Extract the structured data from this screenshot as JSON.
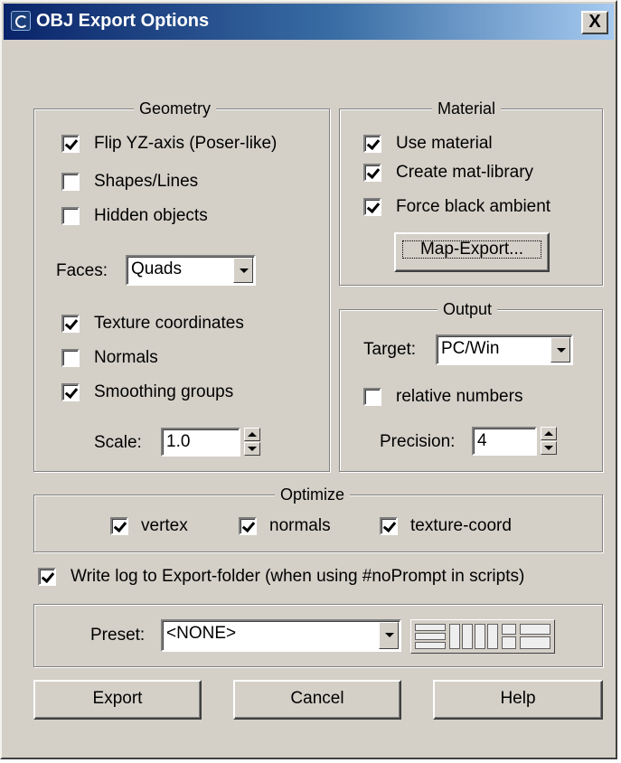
{
  "window": {
    "title": "OBJ Export Options",
    "close_glyph": "X",
    "app_icon": "3ds-max-icon"
  },
  "geometry": {
    "legend": "Geometry",
    "flip_yz": {
      "label": "Flip YZ-axis (Poser-like)",
      "checked": true
    },
    "shapes_lines": {
      "label": "Shapes/Lines",
      "checked": false
    },
    "hidden_objects": {
      "label": "Hidden objects",
      "checked": false
    },
    "faces_label": "Faces:",
    "faces_value": "Quads",
    "texture_coordinates": {
      "label": "Texture coordinates",
      "checked": true
    },
    "normals": {
      "label": "Normals",
      "checked": false
    },
    "smoothing_groups": {
      "label": "Smoothing groups",
      "checked": true
    },
    "scale_label": "Scale:",
    "scale_value": "1.0"
  },
  "material": {
    "legend": "Material",
    "use_material": {
      "label": "Use material",
      "checked": true
    },
    "create_mat_library": {
      "label": "Create mat-library",
      "checked": true
    },
    "force_black_ambient": {
      "label": "Force black ambient",
      "checked": true
    },
    "map_export_label": "Map-Export..."
  },
  "output": {
    "legend": "Output",
    "target_label": "Target:",
    "target_value": "PC/Win",
    "relative_numbers": {
      "label": "relative numbers",
      "checked": false
    },
    "precision_label": "Precision:",
    "precision_value": "4"
  },
  "optimize": {
    "legend": "Optimize",
    "vertex": {
      "label": "vertex",
      "checked": true
    },
    "normals": {
      "label": "normals",
      "checked": true
    },
    "texture_coord": {
      "label": "texture-coord",
      "checked": true
    }
  },
  "write_log": {
    "label": "Write log to Export-folder (when using #noPrompt in scripts)",
    "checked": true
  },
  "preset": {
    "label": "Preset:",
    "value": "<NONE>",
    "icon": "layout-presets-icon"
  },
  "buttons": {
    "export": "Export",
    "cancel": "Cancel",
    "help": "Help"
  }
}
